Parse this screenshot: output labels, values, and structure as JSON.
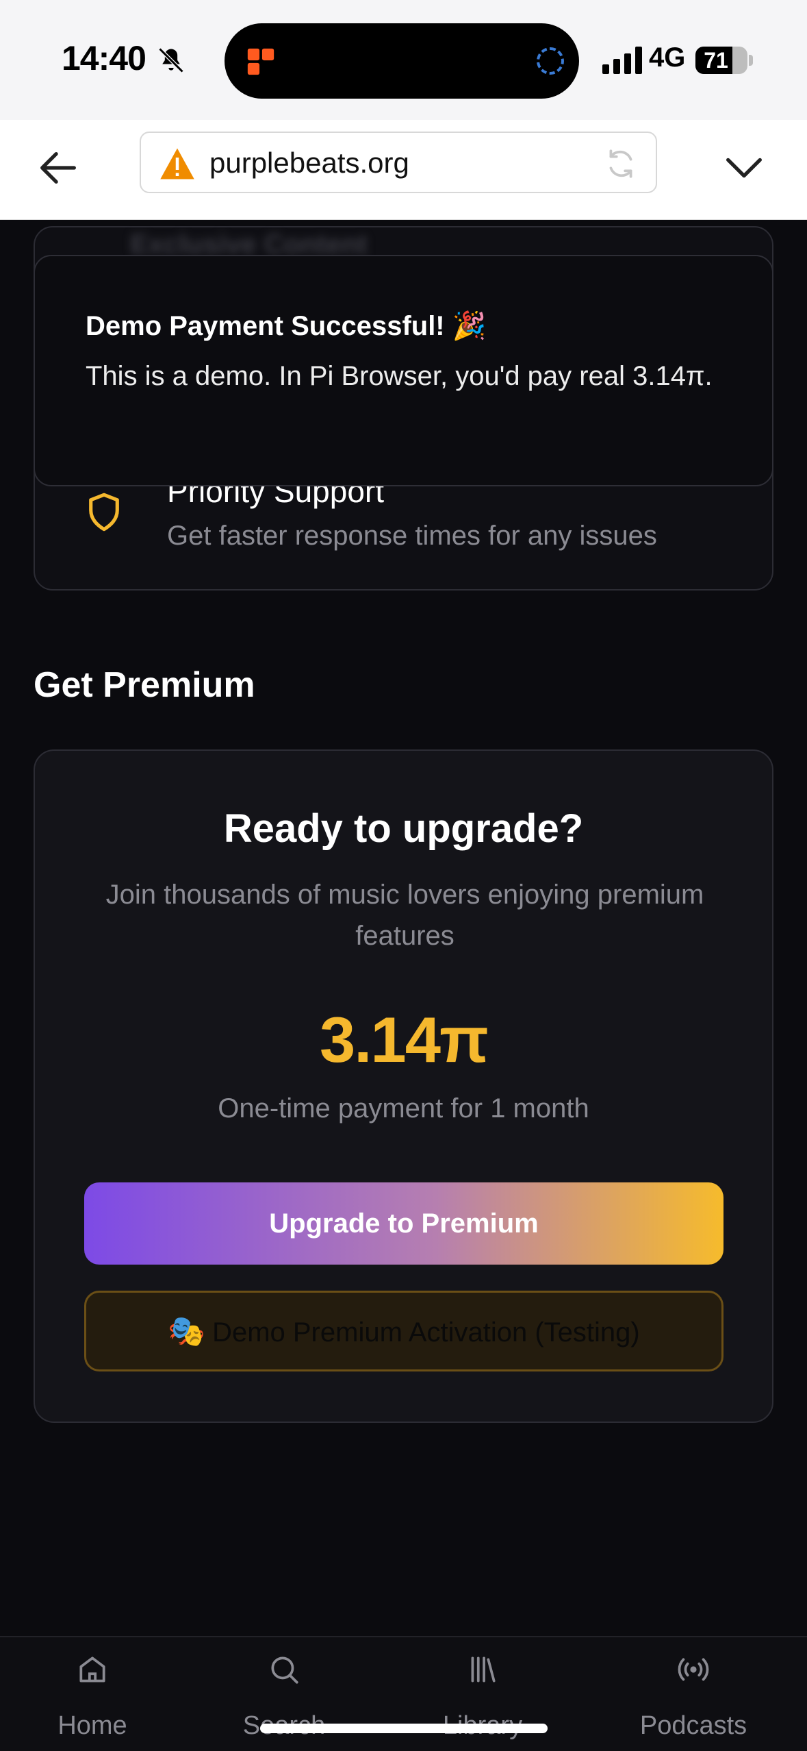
{
  "status_bar": {
    "time": "14:40",
    "network": "4G",
    "battery": "71",
    "battery_level": 0.71
  },
  "browser": {
    "url": "purplebeats.org"
  },
  "background_card": {
    "blurred_heading": "Exclusive Content",
    "feature_title": "Priority Support",
    "feature_desc": "Get faster response times for any issues"
  },
  "toast": {
    "title": "Demo Payment Successful! 🎉",
    "body": "This is a demo. In Pi Browser, you'd pay real 3.14π."
  },
  "section": {
    "title": "Get Premium"
  },
  "premium_card": {
    "heading": "Ready to upgrade?",
    "subtitle": "Join thousands of music lovers enjoying premium features",
    "price": "3.14π",
    "price_note": "One-time payment for 1 month",
    "upgrade_label": "Upgrade to Premium",
    "demo_icon": "🎭",
    "demo_label": "Demo Premium Activation (Testing)"
  },
  "nav": {
    "items": [
      {
        "label": "Home",
        "icon": "home-icon"
      },
      {
        "label": "Search",
        "icon": "search-icon"
      },
      {
        "label": "Library",
        "icon": "library-icon"
      },
      {
        "label": "Podcasts",
        "icon": "podcast-icon"
      }
    ]
  },
  "colors": {
    "accent_gold": "#f5b82e",
    "accent_purple": "#7d4ae6",
    "background": "#0b0b0f"
  }
}
